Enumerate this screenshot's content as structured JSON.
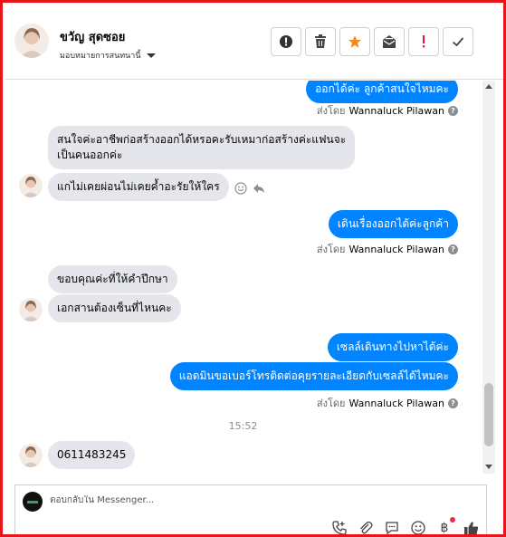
{
  "header": {
    "contact_name": "ขวัญ สุดซอย",
    "assign_label": "มอบหมายการสนทนานี้",
    "actions": [
      {
        "name": "spam-icon"
      },
      {
        "name": "trash-icon"
      },
      {
        "name": "star-icon"
      },
      {
        "name": "mark-unread-icon"
      },
      {
        "name": "follow-up-icon"
      },
      {
        "name": "done-icon"
      }
    ]
  },
  "messages": [
    {
      "id": "m1",
      "direction": "out",
      "text": "ออกได้ค่ะ ลูกค้าสนใจไหมคะ"
    },
    {
      "id": "m2",
      "direction": "in",
      "text": "สนใจค่ะอาชีพก่อสร้างออกได้หรอคะรับเหมาก่อสร้างค่ะแฟนจะ\nเป็นคนออกค่ะ"
    },
    {
      "id": "m3",
      "direction": "in",
      "text": "แกไม่เคยผ่อนไม่เคยค้ำอะรัยให้ใคร"
    },
    {
      "id": "m4",
      "direction": "out",
      "text": "เดินเรื่องออกได้ค่ะลูกค้า"
    },
    {
      "id": "m5",
      "direction": "in",
      "text": "ขอบคุณค่ะที่ให้คำปึกษา"
    },
    {
      "id": "m6",
      "direction": "in",
      "text": "เอกสานต้องเซ็นที่ไหนคะ"
    },
    {
      "id": "m7",
      "direction": "out",
      "text": "เซลล์เดินทางไปหาได้ค่ะ"
    },
    {
      "id": "m8",
      "direction": "out",
      "text": "แอดมินขอเบอร์โทรติดต่อคุยรายละเอียดกับเซลล์ได้ไหมคะ"
    },
    {
      "id": "m9",
      "direction": "in",
      "text": "0611483245"
    }
  ],
  "sent_by": {
    "prefix": "ส่งโดย",
    "name": "Wannaluck Pilawan"
  },
  "timestamp": "15:52",
  "composer": {
    "placeholder": "ตอบกลับใน Messenger...",
    "tools": [
      "call-icon",
      "attachment-icon",
      "saved-reply-icon",
      "emoji-icon",
      "payment-icon",
      "like-icon"
    ]
  },
  "colors": {
    "outgoing": "#0084ff",
    "incoming": "#e4e6eb",
    "frame": "#e8141b"
  }
}
